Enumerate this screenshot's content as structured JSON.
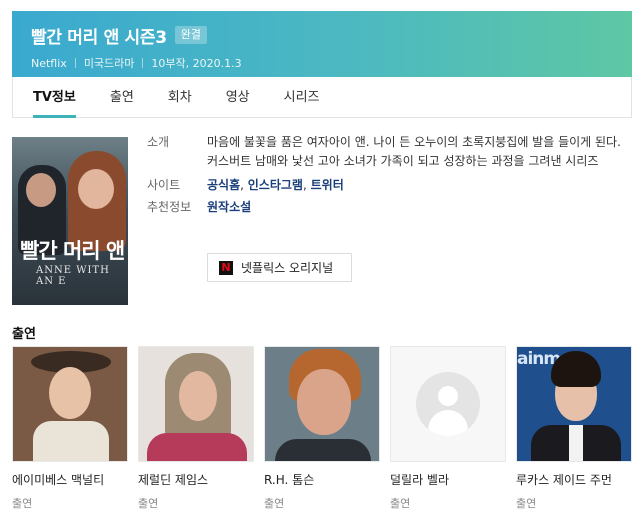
{
  "show": {
    "title": "빨간 머리 앤 시즌3",
    "badge": "완결",
    "meta": [
      "Netflix",
      "미국드라마",
      "10부작, 2020.1.3"
    ]
  },
  "tabs": [
    {
      "label": "TV정보",
      "active": true
    },
    {
      "label": "출연",
      "active": false
    },
    {
      "label": "회차",
      "active": false
    },
    {
      "label": "영상",
      "active": false
    },
    {
      "label": "시리즈",
      "active": false
    }
  ],
  "poster": {
    "title": "빨간 머리 앤",
    "subtitle": "ANNE WITH AN E"
  },
  "info": {
    "intro_label": "소개",
    "intro_text": "마음에 불꽃을 품은 여자아이 앤. 나이 든 오누이의 초록지붕집에 발을 들이게 된다. 커스버트 남매와 낯선 고아 소녀가 가족이 되고 성장하는 과정을 그려낸 시리즈",
    "site_label": "사이트",
    "sites": [
      "공식홈",
      "인스타그램",
      "트위터"
    ],
    "site_sep": ", ",
    "rec_label": "추천정보",
    "rec_value": "원작소설",
    "netflix_button": "넷플릭스 오리지널",
    "netflix_icon_glyph": "N"
  },
  "cast": {
    "heading": "출연",
    "members": [
      {
        "name": "에이미베스 맥널티",
        "role": "출연"
      },
      {
        "name": "제럴딘 제임스",
        "role": "출연"
      },
      {
        "name": "R.H. 톰슨",
        "role": "출연"
      },
      {
        "name": "덜릴라 벨라",
        "role": "출연"
      },
      {
        "name": "루카스 제이드 주먼",
        "role": "출연"
      }
    ],
    "photo5_sign": "ainme"
  },
  "colors": {
    "accent": "#3db2b8",
    "header_start": "#3aa9cf",
    "header_end": "#5ec7a4",
    "link": "#1a3f7a"
  }
}
